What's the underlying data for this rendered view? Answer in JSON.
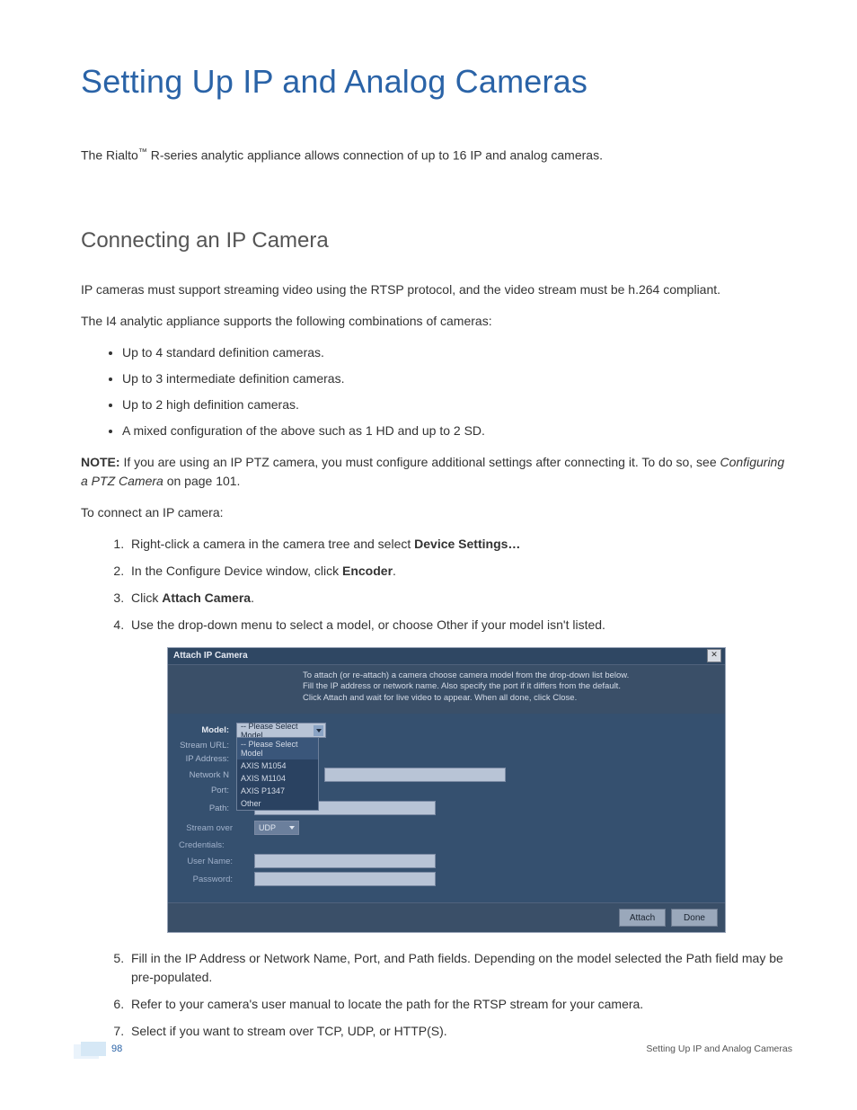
{
  "title": "Setting Up IP and Analog Cameras",
  "intro_pre": "The Rialto",
  "intro_tm": "™",
  "intro_post": " R-series analytic appliance allows connection of up to 16 IP and analog cameras.",
  "section1": "Connecting an IP Camera",
  "p1": "IP cameras must support streaming video using the RTSP protocol, and the video stream must be h.264 compliant.",
  "p2": "The I4 analytic appliance supports the following combinations of cameras:",
  "bullets": [
    "Up to 4 standard definition cameras.",
    "Up to 3 intermediate definition cameras.",
    "Up to 2 high definition cameras.",
    "A mixed configuration of the above such as 1 HD and up to 2 SD."
  ],
  "note_label": "NOTE:",
  "note_body": " If you are using an IP PTZ camera, you must configure additional settings after connecting it. To do so, see ",
  "note_ref": "Configuring a PTZ Camera",
  "note_tail": " on page 101.",
  "p3": "To connect an IP camera:",
  "step1_pre": "Right-click a camera in the camera tree and select ",
  "step1_bold": "Device Settings…",
  "step2_pre": "In the Configure Device window, click ",
  "step2_bold": "Encoder",
  "step2_post": ".",
  "step3_pre": "Click ",
  "step3_bold": "Attach Camera",
  "step3_post": ".",
  "step4": "Use the drop-down menu to select a model, or choose Other if your model isn't listed.",
  "step5": "Fill in the IP Address or Network Name, Port, and Path fields. Depending on the model selected the Path field may be pre-populated.",
  "step6": "Refer to your camera's user manual to locate the path for the RTSP stream for your camera.",
  "step7": "Select if you want to stream over TCP, UDP, or HTTP(S).",
  "dialog": {
    "title": "Attach IP Camera",
    "instructions": "To attach (or re-attach) a camera choose camera model from the drop-down list below.\nFill the IP address or network name. Also specify the port if it differs from the default.\nClick Attach and wait for live video to appear. When all done, click Close.",
    "labels": {
      "model": "Model:",
      "stream_url": "Stream URL:",
      "ip": "IP Address:",
      "network": "Network N",
      "port": "Port:",
      "path": "Path:",
      "stream_over": "Stream over",
      "credentials": "Credentials:",
      "username": "User Name:",
      "password": "Password:"
    },
    "model_selected": "-- Please Select Model",
    "model_options": [
      "-- Please Select Model",
      "AXIS M1054",
      "AXIS M1104",
      "AXIS P1347",
      "Other"
    ],
    "stream_over_value": "UDP",
    "buttons": {
      "attach": "Attach",
      "done": "Done"
    }
  },
  "footer": {
    "page_number": "98",
    "title": "Setting Up IP and Analog Cameras"
  }
}
